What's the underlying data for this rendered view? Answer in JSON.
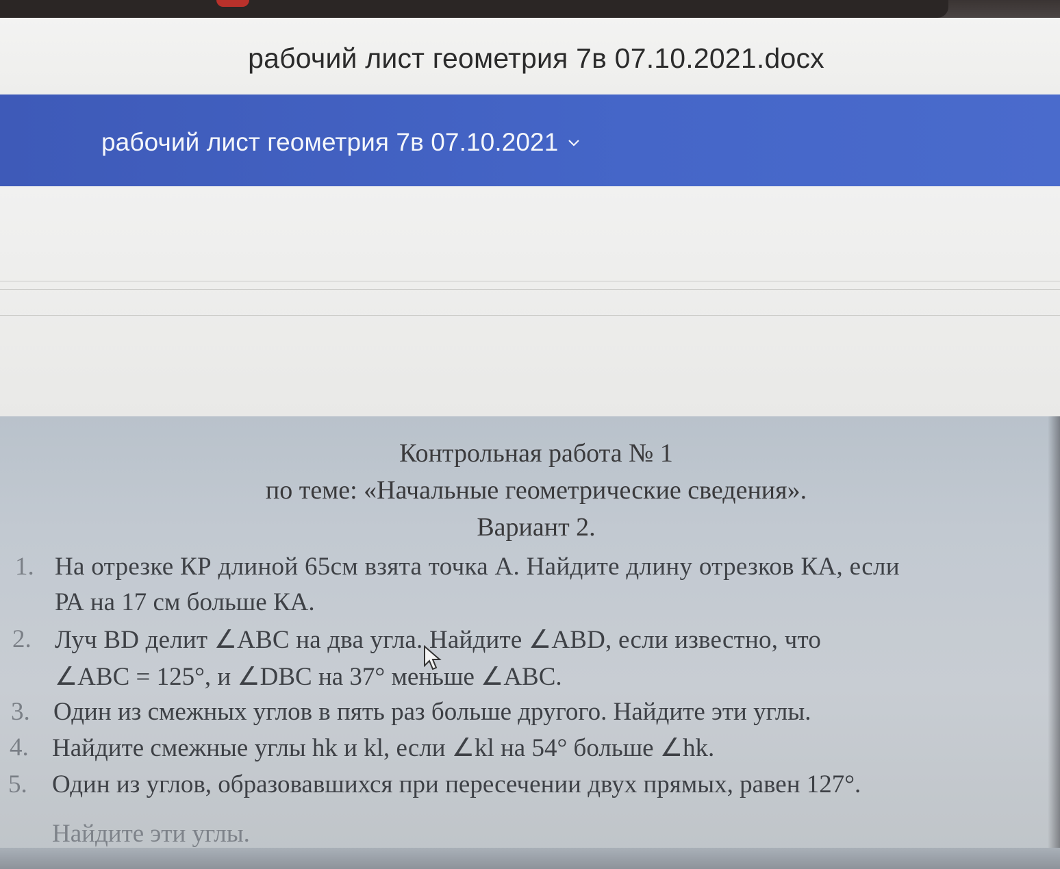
{
  "file_header": {
    "title": "рабочий лист геометрия 7в 07.10.2021.docx"
  },
  "ribbon": {
    "document_name": "рабочий лист геометрия 7в 07.10.2021"
  },
  "document": {
    "heading": "Контрольная работа № 1",
    "topic": "по теме: «Начальные геометрические сведения».",
    "variant": "Вариант 2.",
    "items": [
      {
        "number": "1.",
        "lines": [
          "На отрезке  КР длиной 65см взята точка А. Найдите длину отрезков КА, если",
          "РА  на 17 см больше КА."
        ]
      },
      {
        "number": "2.",
        "lines": [
          "Луч  BD  делит  ∠ABC  на  два  угла.  Найдите  ∠ABD,  если  известно,  что",
          "∠ABC = 125°, и ∠DBC на 37° меньше ∠ABC."
        ]
      },
      {
        "number": "3.",
        "lines": [
          "Один из смежных углов в пять раз больше другого. Найдите эти углы."
        ]
      },
      {
        "number": "4.",
        "lines": [
          "Найдите смежные углы hk и  kl, если ∠kl на 54° больше ∠hk."
        ]
      },
      {
        "number": "5.",
        "lines": [
          "Один из углов, образовавшихся при пересечении двух прямых, равен 127°.",
          "Найдите эти углы."
        ]
      }
    ]
  },
  "colors": {
    "ribbon": "#4566c8",
    "page": "#c2c9d1",
    "text": "#3a3a3c"
  },
  "icons": {
    "dropdown": "chevron-down-icon",
    "pointer": "mouse-cursor-icon"
  }
}
